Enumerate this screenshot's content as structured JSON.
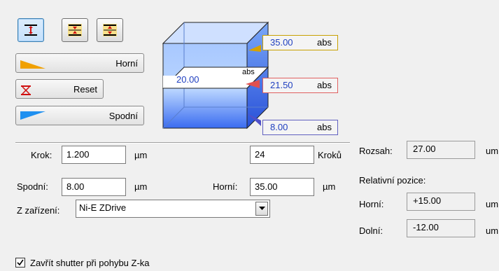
{
  "toolbar": {
    "mode_buttons": [
      {
        "icon": "range-icon",
        "active": true
      },
      {
        "icon": "center-icon",
        "active": false
      },
      {
        "icon": "from-center-icon",
        "active": false
      }
    ],
    "top_label": "Horní",
    "reset_label": "Reset",
    "bottom_label": "Spodní"
  },
  "diagram": {
    "top_value": "35.00",
    "top_unit": "abs",
    "current_value": "21.50",
    "current_unit": "abs",
    "bottom_value": "8.00",
    "bottom_unit": "abs",
    "range_value": "20.00",
    "range_unit": "abs",
    "colors": {
      "top": "#e0a800",
      "current": "#e05050",
      "bottom": "#5050c8",
      "cube": "#3c78ff"
    }
  },
  "form": {
    "step_label": "Krok:",
    "step_value": "1.200",
    "step_unit": "µm",
    "steps_value": "24",
    "steps_label": "Kroků",
    "bottom_label": "Spodní:",
    "bottom_value": "8.00",
    "bottom_unit": "µm",
    "top_label": "Horní:",
    "top_value": "35.00",
    "top_unit": "µm",
    "device_label": "Z zařízení:",
    "device_value": "Ni-E ZDrive"
  },
  "info": {
    "range_label": "Rozsah:",
    "range_value": "27.00",
    "range_unit": "um",
    "relative_label": "Relativní pozice:",
    "rel_top_label": "Horní:",
    "rel_top_value": "+15.00",
    "rel_top_unit": "um",
    "rel_bottom_label": "Dolní:",
    "rel_bottom_value": "-12.00",
    "rel_bottom_unit": "um"
  },
  "shutter": {
    "label": "Zavřít shutter při pohybu Z-ka",
    "checked": true
  }
}
